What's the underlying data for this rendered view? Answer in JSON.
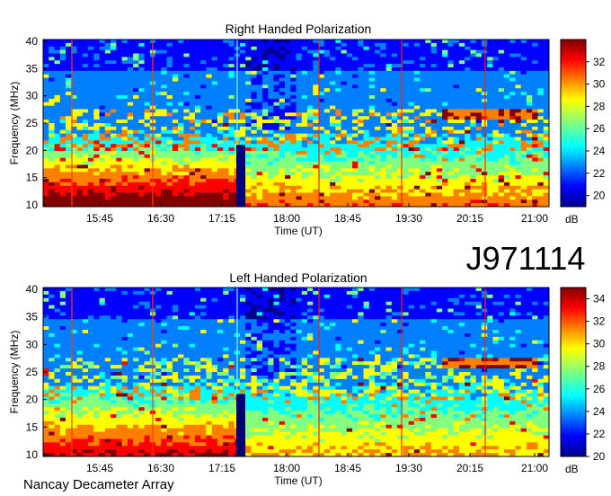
{
  "chart_data": [
    {
      "type": "heatmap",
      "title": "Right Handed Polarization",
      "xlabel": "Time (UT)",
      "ylabel": "Frequency (MHz)",
      "x_ticks": [
        "15:45",
        "16:30",
        "17:15",
        "18:00",
        "18:45",
        "19:30",
        "20:15",
        "21:00"
      ],
      "y_ticks": [
        "10",
        "15",
        "20",
        "25",
        "30",
        "35",
        "40"
      ],
      "ylim": [
        10,
        40
      ],
      "colorbar": {
        "label": "dB",
        "ticks": [
          "20",
          "22",
          "24",
          "26",
          "28",
          "30",
          "32"
        ],
        "range": [
          19,
          34
        ]
      }
    },
    {
      "type": "heatmap",
      "title": "Left Handed Polarization",
      "xlabel": "Time (UT)",
      "ylabel": "Frequency (MHz)",
      "x_ticks": [
        "15:45",
        "16:30",
        "17:15",
        "18:00",
        "18:45",
        "19:30",
        "20:15",
        "21:00"
      ],
      "y_ticks": [
        "10",
        "15",
        "20",
        "25",
        "30",
        "35",
        "40"
      ],
      "ylim": [
        10,
        40
      ],
      "colorbar": {
        "label": "dB",
        "ticks": [
          "20",
          "22",
          "24",
          "26",
          "28",
          "30",
          "32",
          "34"
        ],
        "range": [
          20,
          35
        ]
      }
    }
  ],
  "event_label": "J971114",
  "instrument": "Nancay Decameter Array",
  "colormap": [
    "#00008f",
    "#0000ff",
    "#0080ff",
    "#00ffff",
    "#80ff80",
    "#ffff00",
    "#ff8000",
    "#ff0000",
    "#800000"
  ]
}
